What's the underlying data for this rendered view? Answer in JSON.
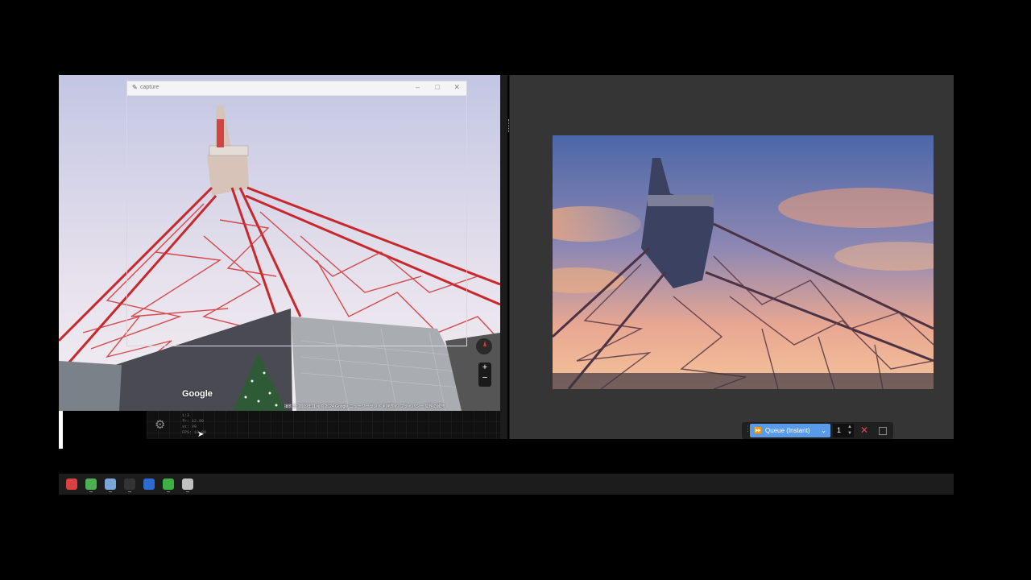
{
  "capture_window": {
    "title": "capture",
    "controls": {
      "minimize": "–",
      "maximize": "□",
      "close": "✕"
    }
  },
  "street_view": {
    "google_logo": "Google",
    "footer": "撮影日: 2009年11月   © 2024 Google   ニュージーランド   利用規約   プライバシー   問題の報告",
    "zoom_in": "+",
    "zoom_out": "−"
  },
  "settings_panel": {
    "stats": [
      "1:3",
      "fr: 12.00",
      "st: #0",
      "FPS: 10.00"
    ]
  },
  "queue_bar": {
    "button_label": "Queue (Instant)",
    "count": "1",
    "cancel_icon": "✕"
  },
  "taskbar": {
    "items": [
      {
        "name": "app-icon-1",
        "color": "#d94040",
        "active": false
      },
      {
        "name": "chrome-icon",
        "color": "#4caf50",
        "active": true
      },
      {
        "name": "comfyui-icon",
        "color": "#7aa6d8",
        "active": true
      },
      {
        "name": "terminal-icon",
        "color": "#333333",
        "active": true
      },
      {
        "name": "pen-icon",
        "color": "#2d6bd1",
        "active": false
      },
      {
        "name": "chat-icon",
        "color": "#3cb043",
        "active": true
      },
      {
        "name": "app-icon-7",
        "color": "#c0c0c0",
        "active": true
      }
    ]
  }
}
